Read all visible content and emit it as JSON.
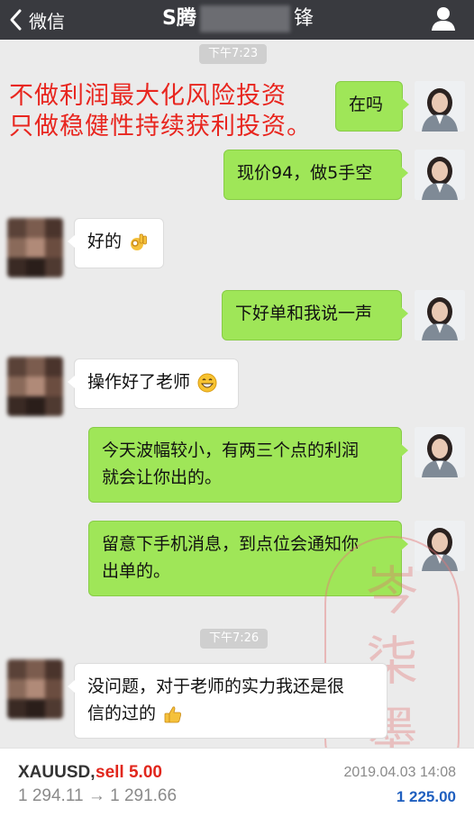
{
  "header": {
    "back_label": "微信",
    "title_prefix": "S腾",
    "title_suffix": "锋"
  },
  "overlay_note": {
    "line1": "不做利润最大化风险投资",
    "line2": "只做稳健性持续获利投资。"
  },
  "timestamps": [
    "下午7:23",
    "下午7:26"
  ],
  "messages": [
    {
      "side": "right",
      "text": "在吗"
    },
    {
      "side": "right",
      "text": "现价94，做5手空"
    },
    {
      "side": "left",
      "text": "好的",
      "emoji": "ok-hand"
    },
    {
      "side": "right",
      "text": "下好单和我说一声"
    },
    {
      "side": "left",
      "text": "操作好了老师",
      "emoji": "grinning"
    },
    {
      "side": "right",
      "line1": "今天波幅较小，有两三个点的利润",
      "line2": "就会让你出的。"
    },
    {
      "side": "right",
      "line1": "留意下手机消息，到点位会通知你",
      "line2": "出单的。"
    },
    {
      "side": "left",
      "line1": "没问题，对于老师的实力我还是很",
      "line2": "信的过的",
      "emoji": "thumbs-up"
    }
  ],
  "stamp": {
    "chars": "岑柒墨"
  },
  "trade": {
    "symbol": "XAUUSD,",
    "action": "sell 5.00",
    "prices": "1 294.11 → 1 291.66",
    "date": "2019.04.03 14:08",
    "profit": "1 225.00"
  },
  "colors": {
    "topbar": "#393a3f",
    "green_bubble": "#9fe658",
    "note_red": "#e8261f",
    "sell_red": "#e1261c",
    "profit_blue": "#1f5fbf"
  }
}
